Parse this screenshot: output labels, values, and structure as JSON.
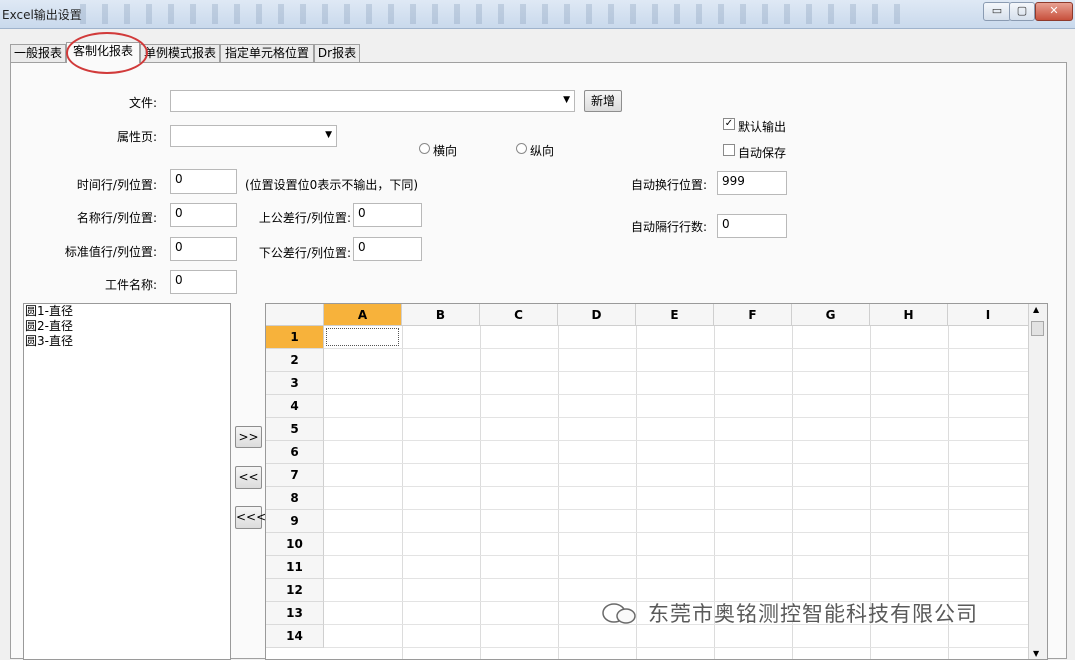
{
  "window": {
    "title": "Excel输出设置",
    "controls": {
      "minimize": "▭",
      "maximize": "▢",
      "close": "✕"
    }
  },
  "tabs": [
    {
      "label": "一般报表"
    },
    {
      "label": "客制化报表",
      "active": true
    },
    {
      "label": "单例模式报表"
    },
    {
      "label": "指定单元格位置"
    },
    {
      "label": "Dr报表"
    }
  ],
  "form": {
    "file_label": "文件:",
    "file_value": "",
    "add_button": "新增",
    "property_label": "属性页:",
    "property_value": "",
    "orientation_horizontal": "横向",
    "orientation_vertical": "纵向",
    "default_output": "默认输出",
    "default_output_checked": true,
    "auto_save": "自动保存",
    "auto_save_checked": false,
    "time_label": "时间行/列位置:",
    "time_value": "0",
    "position_hint": "(位置设置位0表示不输出，下同)",
    "name_label": "名称行/列位置:",
    "name_value": "0",
    "upper_tol_label": "上公差行/列位置:",
    "upper_tol_value": "0",
    "std_label": "标准值行/列位置:",
    "std_value": "0",
    "lower_tol_label": "下公差行/列位置:",
    "lower_tol_value": "0",
    "part_label": "工件名称:",
    "part_value": "0",
    "wrap_pos_label": "自动换行位置:",
    "wrap_pos_value": "999",
    "skip_rows_label": "自动隔行行数:",
    "skip_rows_value": "0"
  },
  "features": [
    "圆1-直径",
    "圆2-直径",
    "圆3-直径"
  ],
  "move_buttons": {
    "add": ">>",
    "remove": "<<",
    "remove_all": "<<<"
  },
  "sheet": {
    "columns": [
      "A",
      "B",
      "C",
      "D",
      "E",
      "F",
      "G",
      "H",
      "I"
    ],
    "rows": [
      "1",
      "2",
      "3",
      "4",
      "5",
      "6",
      "7",
      "8",
      "9",
      "10",
      "11",
      "12",
      "13",
      "14"
    ],
    "selected_column": "A",
    "selected_row": "1",
    "highlight_color": "#f7b23b"
  },
  "watermark": "东莞市奥铭测控智能科技有限公司"
}
